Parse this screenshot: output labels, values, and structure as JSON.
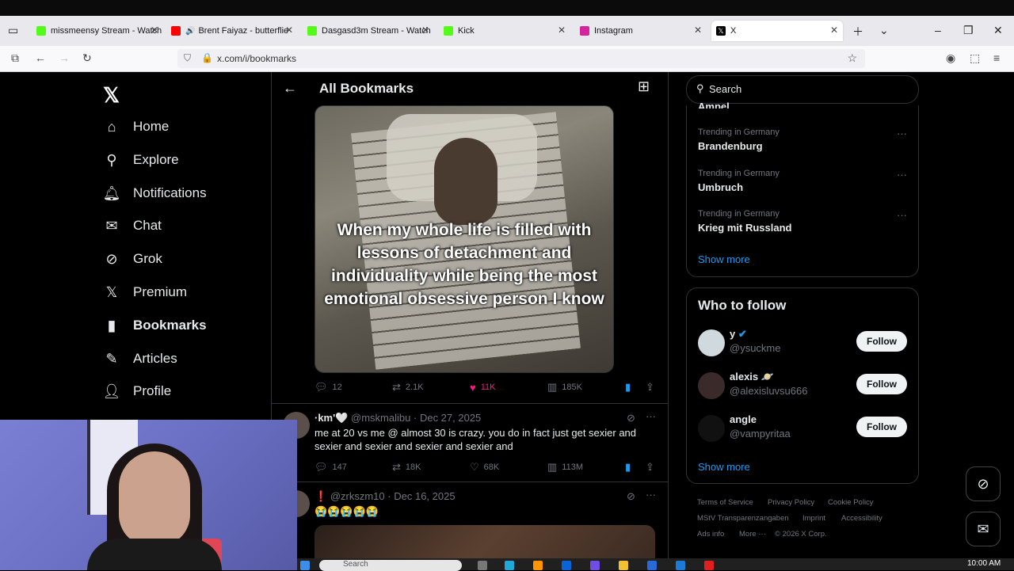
{
  "browser": {
    "tabs": [
      {
        "label": "missmeensy Stream - Watch",
        "favicon_color": "#53fc18"
      },
      {
        "label": "Brent Faiyaz - butterflie",
        "favicon_color": "#ff0000",
        "extra_icon": "speaker-icon"
      },
      {
        "label": "Dasgasd3m Stream - Watch",
        "favicon_color": "#53fc18"
      },
      {
        "label": "Kick",
        "favicon_color": "#53fc18"
      },
      {
        "label": "Instagram",
        "favicon_color": "#d6249f"
      },
      {
        "label": "X",
        "favicon_color": "#000000"
      }
    ],
    "url": "x.com/i/bookmarks"
  },
  "nav": {
    "items": [
      {
        "label": "Home",
        "icon": "home-icon"
      },
      {
        "label": "Explore",
        "icon": "search-icon"
      },
      {
        "label": "Notifications",
        "icon": "bell-icon"
      },
      {
        "label": "Chat",
        "icon": "mail-icon"
      },
      {
        "label": "Grok",
        "icon": "grok-icon"
      },
      {
        "label": "Premium",
        "icon": "x-logo-icon"
      },
      {
        "label": "Bookmarks",
        "icon": "bookmark-icon"
      },
      {
        "label": "Articles",
        "icon": "articles-icon"
      },
      {
        "label": "Profile",
        "icon": "profile-icon"
      }
    ]
  },
  "main": {
    "title": "All Bookmarks",
    "media_caption": "When my whole life is filled with lessons of detachment and individuality while being the most emotional obsessive person I know",
    "first_actions": {
      "replies": "12",
      "reposts": "2.1K",
      "likes": "11K",
      "views": "185K"
    },
    "tweets": [
      {
        "name": "·km'🤍",
        "handle": "@mskmalibu",
        "date": "Dec 27, 2025",
        "text": "me at 20 vs me @ almost 30 is crazy. you do in fact just get sexier and sexier and sexier and sexier and sexier and",
        "replies": "147",
        "reposts": "18K",
        "likes": "68K",
        "views": "113M"
      },
      {
        "name": "❗",
        "handle": "@zrkszm10",
        "date": "Dec 16, 2025",
        "text": "😭😭😭😭😭"
      }
    ]
  },
  "sidebar": {
    "search_placeholder": "Search",
    "partial_trend": "Ampel",
    "trends": [
      {
        "context": "Trending in Germany",
        "name": "Brandenburg"
      },
      {
        "context": "Trending in Germany",
        "name": "Umbruch"
      },
      {
        "context": "Trending in Germany",
        "name": "Krieg mit Russland"
      }
    ],
    "trends_show_more": "Show more",
    "who_to_follow_title": "Who to follow",
    "follow_suggestions": [
      {
        "name": "y",
        "handle": "@ysuckme",
        "verified": true
      },
      {
        "name": "alexis 🪐",
        "handle": "@alexisluvsu666",
        "verified": false
      },
      {
        "name": "angle",
        "handle": "@vampyritaa",
        "verified": false
      }
    ],
    "follow_label": "Follow",
    "wtf_show_more": "Show more",
    "footer": [
      "Terms of Service",
      "Privacy Policy",
      "Cookie Policy",
      "MStV Transparenzangaben",
      "Imprint",
      "Accessibility",
      "Ads info",
      "More ···",
      "© 2026 X Corp."
    ]
  },
  "taskbar": {
    "search_label": "Search",
    "time": "10:00 AM"
  }
}
